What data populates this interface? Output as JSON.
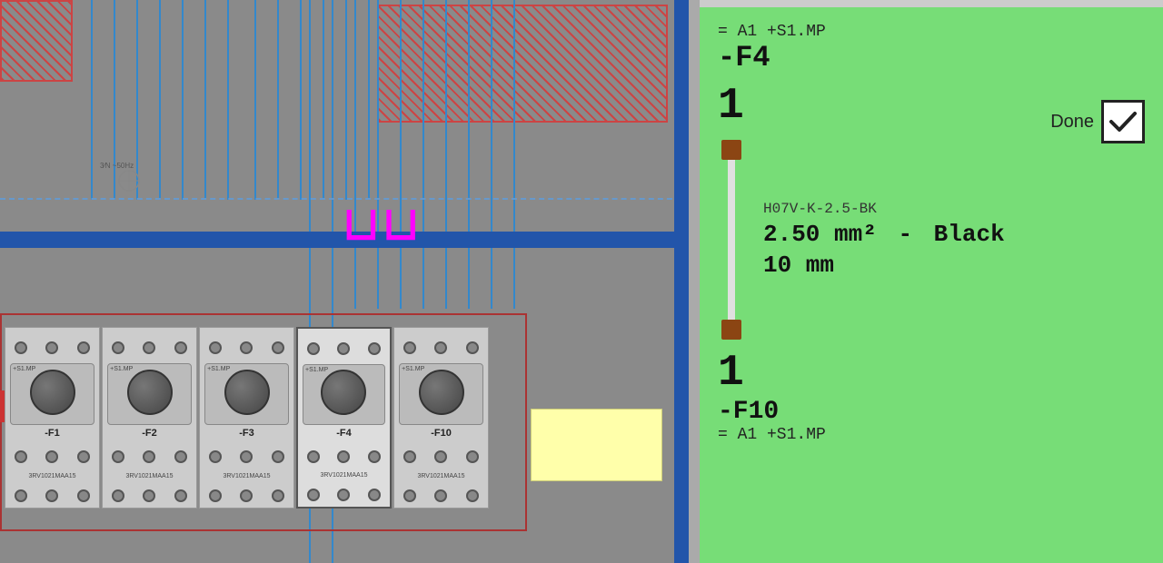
{
  "left_panel": {
    "label": "electrical-diagram"
  },
  "right_panel": {
    "location": "= A1 +S1.MP",
    "component_id": "-F4",
    "quantity_1": "1",
    "done_label": "Done",
    "wire_code": "H07V-K-2.5-BK",
    "wire_size": "2.50 mm²",
    "wire_dash": "-",
    "wire_color": "Black",
    "wire_length": "10 mm",
    "quantity_2": "1",
    "component_id_2": "-F10",
    "location_2": "= A1 +S1.MP"
  },
  "breakers": [
    {
      "name": "-F1",
      "type": "3RV1021MAA15"
    },
    {
      "name": "-F2",
      "type": "3RV1021MAA15"
    },
    {
      "name": "-F3",
      "type": "3RV1021MAA15"
    },
    {
      "name": "-F4",
      "type": "3RV1021MAA15"
    },
    {
      "name": "-F10",
      "type": "3RV1021MAA15"
    }
  ]
}
